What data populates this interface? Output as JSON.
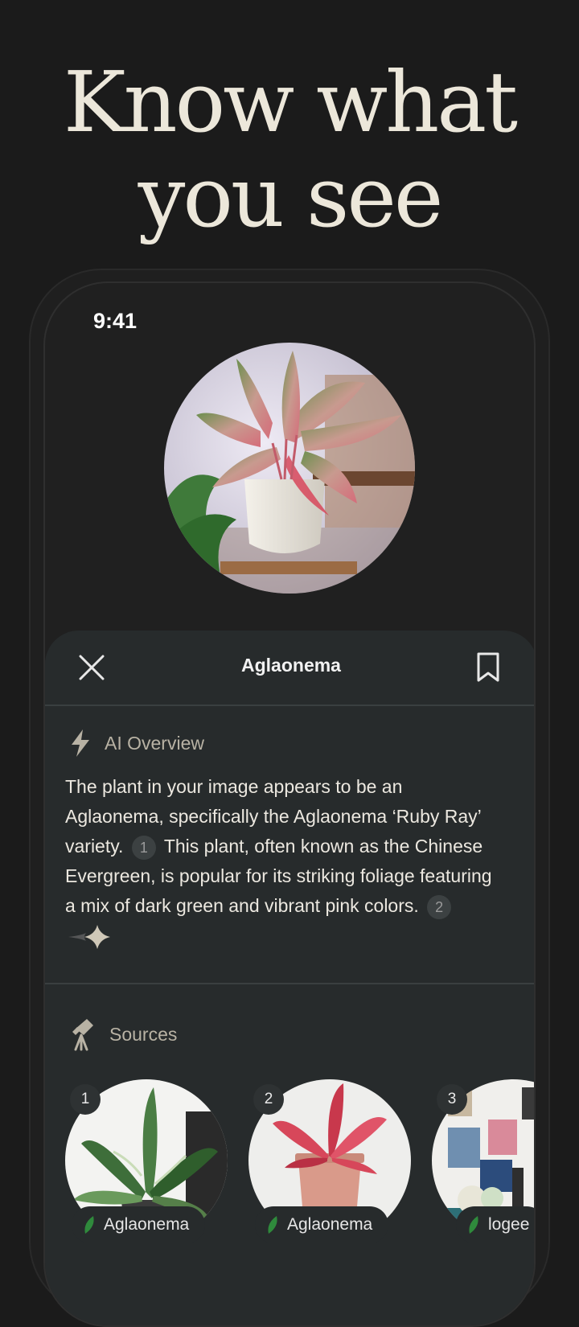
{
  "headline": {
    "line1": "Know what",
    "line2": "you see"
  },
  "status_bar": {
    "time": "9:41"
  },
  "sheet": {
    "title": "Aglaonema",
    "ai_overview": {
      "label": "AI Overview",
      "text_part1": "The plant in your image appears to be an Aglaonema, specifically the Aglaonema ‘Ruby Ray’ variety.",
      "cite1": "1",
      "text_part2": "This plant, often known as the Chinese Evergreen, is popular for its striking foliage featuring a mix of dark green and vibrant pink colors.",
      "cite2": "2"
    },
    "sources": {
      "label": "Sources",
      "items": [
        {
          "num": "1",
          "name": "Aglaonema"
        },
        {
          "num": "2",
          "name": "Aglaonema"
        },
        {
          "num": "3",
          "name": "logee"
        }
      ]
    }
  },
  "colors": {
    "leaf_green": "#2f8a3c",
    "pink": "#d7475a",
    "sheet_bg": "#272b2c"
  },
  "icons": [
    "close-icon",
    "bookmark-icon",
    "lightning-icon",
    "telescope-icon",
    "sparkle-icon",
    "leaf-icon"
  ]
}
